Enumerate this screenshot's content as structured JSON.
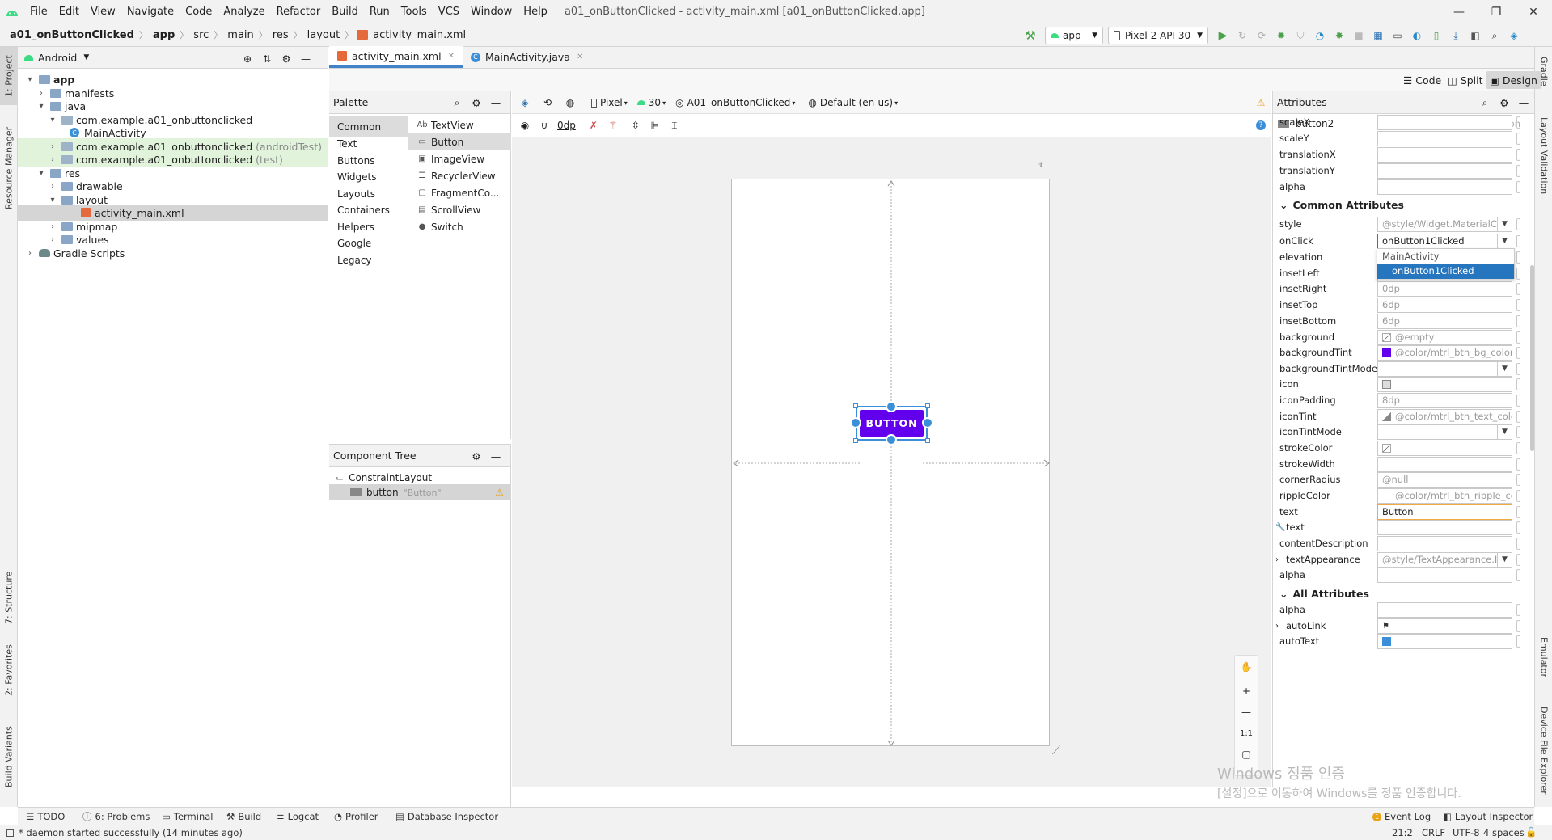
{
  "menubar": {
    "items": [
      "File",
      "Edit",
      "View",
      "Navigate",
      "Code",
      "Analyze",
      "Refactor",
      "Build",
      "Run",
      "Tools",
      "VCS",
      "Window",
      "Help"
    ],
    "window_title": "a01_onButtonClicked - activity_main.xml [a01_onButtonClicked.app]"
  },
  "navbar": {
    "breadcrumbs": [
      "a01_onButtonClicked",
      "app",
      "src",
      "main",
      "res",
      "layout",
      "activity_main.xml"
    ],
    "run_config": "app",
    "device": "Pixel 2 API 30"
  },
  "left_strip": {
    "project": "1: Project",
    "resource_manager": "Resource Manager",
    "structure": "7: Structure",
    "favorites": "2: Favorites",
    "build_variants": "Build Variants"
  },
  "right_strip": {
    "gradle": "Gradle",
    "layout_validation": "Layout Validation",
    "emulator": "Emulator",
    "device_file_explorer": "Device File Explorer"
  },
  "project": {
    "view": "Android",
    "tree": [
      {
        "label": "app",
        "suffix": ""
      },
      {
        "label": "manifests",
        "suffix": ""
      },
      {
        "label": "java",
        "suffix": ""
      },
      {
        "label": "com.example.a01_onbuttonclicked",
        "suffix": ""
      },
      {
        "label": "MainActivity",
        "suffix": ""
      },
      {
        "label": "com.example.a01_onbuttonclicked",
        "suffix": "(androidTest)"
      },
      {
        "label": "com.example.a01_onbuttonclicked",
        "suffix": "(test)"
      },
      {
        "label": "res",
        "suffix": ""
      },
      {
        "label": "drawable",
        "suffix": ""
      },
      {
        "label": "layout",
        "suffix": ""
      },
      {
        "label": "activity_main.xml",
        "suffix": ""
      },
      {
        "label": "mipmap",
        "suffix": ""
      },
      {
        "label": "values",
        "suffix": ""
      },
      {
        "label": "Gradle Scripts",
        "suffix": ""
      }
    ]
  },
  "editor_tabs": [
    "activity_main.xml",
    "MainActivity.java"
  ],
  "modes": {
    "code": "Code",
    "split": "Split",
    "design": "Design"
  },
  "palette": {
    "title": "Palette",
    "categories": [
      "Common",
      "Text",
      "Buttons",
      "Widgets",
      "Layouts",
      "Containers",
      "Helpers",
      "Google",
      "Legacy"
    ],
    "items": [
      {
        "icon": "Ab",
        "label": "TextView"
      },
      {
        "icon": "▭",
        "label": "Button"
      },
      {
        "icon": "▣",
        "label": "ImageView"
      },
      {
        "icon": "☰",
        "label": "RecyclerView"
      },
      {
        "icon": "▢",
        "label": "FragmentCo..."
      },
      {
        "icon": "▤",
        "label": "ScrollView"
      },
      {
        "icon": "●",
        "label": "Switch"
      }
    ]
  },
  "component_tree": {
    "title": "Component Tree",
    "root": "ConstraintLayout",
    "child": "button",
    "child_text": "\"Button\""
  },
  "design_toolbar": {
    "device": "Pixel",
    "api": "30",
    "activity": "A01_onButtonClicked",
    "locale": "Default (en-us)",
    "margin": "0dp"
  },
  "canvas": {
    "button_text": "BUTTON",
    "button_color": "#6200ee"
  },
  "zoom": {
    "ratio": "1:1"
  },
  "attributes": {
    "title": "Attributes",
    "component_id": "button2",
    "component_type": "Button",
    "transforms": [
      {
        "name": "scaleX",
        "value": ""
      },
      {
        "name": "scaleY",
        "value": ""
      },
      {
        "name": "translationX",
        "value": ""
      },
      {
        "name": "translationY",
        "value": ""
      },
      {
        "name": "alpha",
        "value": ""
      }
    ],
    "common_title": "Common Attributes",
    "common": [
      {
        "name": "style",
        "value": "@style/Widget.MaterialC"
      },
      {
        "name": "onClick",
        "value": "onButton1Clicked"
      },
      {
        "name": "elevation",
        "value": ""
      },
      {
        "name": "insetLeft",
        "value": ""
      },
      {
        "name": "insetRight",
        "value": "0dp"
      },
      {
        "name": "insetTop",
        "value": "6dp"
      },
      {
        "name": "insetBottom",
        "value": "6dp"
      },
      {
        "name": "background",
        "value": "@empty"
      },
      {
        "name": "backgroundTint",
        "value": "@color/mtrl_btn_bg_color_"
      },
      {
        "name": "backgroundTintMode",
        "value": ""
      },
      {
        "name": "icon",
        "value": ""
      },
      {
        "name": "iconPadding",
        "value": "8dp"
      },
      {
        "name": "iconTint",
        "value": "@color/mtrl_btn_text_color"
      },
      {
        "name": "iconTintMode",
        "value": ""
      },
      {
        "name": "strokeColor",
        "value": ""
      },
      {
        "name": "strokeWidth",
        "value": ""
      },
      {
        "name": "cornerRadius",
        "value": "@null"
      },
      {
        "name": "rippleColor",
        "value": "@color/mtrl_btn_ripple_col"
      },
      {
        "name": "text",
        "value": "Button"
      },
      {
        "name": "text",
        "value": ""
      },
      {
        "name": "contentDescription",
        "value": ""
      },
      {
        "name": "textAppearance",
        "value": "@style/TextAppearance.I"
      },
      {
        "name": "alpha",
        "value": ""
      }
    ],
    "all_title": "All Attributes",
    "all": [
      {
        "name": "alpha",
        "value": ""
      },
      {
        "name": "autoLink",
        "value": ""
      },
      {
        "name": "autoText",
        "value": ""
      }
    ],
    "onclick_options": [
      "MainActivity",
      "onButton1Clicked"
    ]
  },
  "bottom_tabs": [
    "TODO",
    "6: Problems",
    "Terminal",
    "Build",
    "Logcat",
    "Profiler",
    "Database Inspector",
    "Event Log",
    "Layout Inspector"
  ],
  "status": {
    "message": "* daemon started successfully (14 minutes ago)",
    "position": "21:2",
    "line_ending": "CRLF",
    "encoding": "UTF-8",
    "indent": "4 spaces"
  },
  "watermark": {
    "line1": "Windows 정품 인증",
    "line2": "[설정]으로 이동하여 Windows를 정품 인증합니다."
  },
  "colors": {
    "accent": "#4083c9",
    "button": "#6200ee",
    "selection": "#2675bf",
    "android_green": "#3ddc84"
  }
}
